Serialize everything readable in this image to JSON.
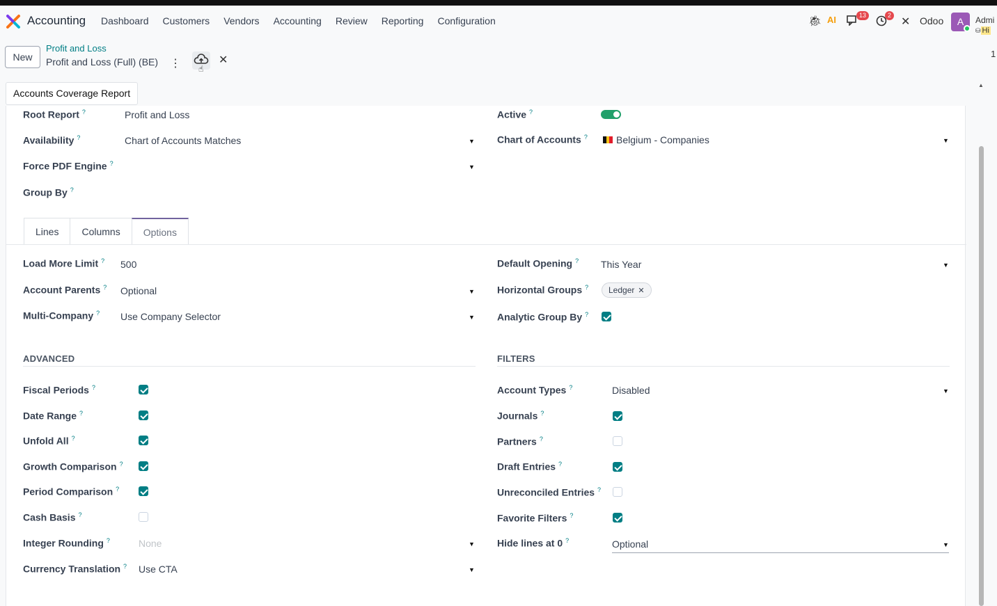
{
  "navbar": {
    "app_name": "Accounting",
    "menu": [
      "Dashboard",
      "Customers",
      "Vendors",
      "Accounting",
      "Review",
      "Reporting",
      "Configuration"
    ],
    "messages_badge": "13",
    "activities_badge": "2",
    "company": "Odoo",
    "avatar_letter": "A",
    "user": "Admi",
    "db": "Hi"
  },
  "control_panel": {
    "new_label": "New",
    "breadcrumb_parent": "Profit and Loss",
    "breadcrumb_current": "Profit and Loss (Full) (BE)",
    "pager": "1"
  },
  "coverage_button": "Accounts Coverage Report",
  "header_fields": {
    "root_report": {
      "label": "Root Report",
      "value": "Profit and Loss"
    },
    "availability": {
      "label": "Availability",
      "value": "Chart of Accounts Matches"
    },
    "force_pdf": {
      "label": "Force PDF Engine",
      "value": ""
    },
    "group_by": {
      "label": "Group By",
      "value": ""
    },
    "active": {
      "label": "Active",
      "value": true
    },
    "chart_of_accounts": {
      "label": "Chart of Accounts",
      "value": "Belgium - Companies"
    }
  },
  "tabs": [
    "Lines",
    "Columns",
    "Options"
  ],
  "options": {
    "load_more_limit": {
      "label": "Load More Limit",
      "value": "500"
    },
    "account_parents": {
      "label": "Account Parents",
      "value": "Optional"
    },
    "multi_company": {
      "label": "Multi-Company",
      "value": "Use Company Selector"
    },
    "default_opening": {
      "label": "Default Opening",
      "value": "This Year"
    },
    "horizontal_groups": {
      "label": "Horizontal Groups",
      "tag": "Ledger"
    },
    "analytic_group_by": {
      "label": "Analytic Group By",
      "checked": true
    }
  },
  "advanced": {
    "title": "ADVANCED",
    "fiscal_periods": {
      "label": "Fiscal Periods",
      "checked": true
    },
    "date_range": {
      "label": "Date Range",
      "checked": true
    },
    "unfold_all": {
      "label": "Unfold All",
      "checked": true
    },
    "growth_comparison": {
      "label": "Growth Comparison",
      "checked": true
    },
    "period_comparison": {
      "label": "Period Comparison",
      "checked": true
    },
    "cash_basis": {
      "label": "Cash Basis",
      "checked": false
    },
    "integer_rounding": {
      "label": "Integer Rounding",
      "placeholder": "None"
    },
    "currency_translation": {
      "label": "Currency Translation",
      "value": "Use CTA"
    }
  },
  "filters": {
    "title": "FILTERS",
    "account_types": {
      "label": "Account Types",
      "value": "Disabled"
    },
    "journals": {
      "label": "Journals",
      "checked": true
    },
    "partners": {
      "label": "Partners",
      "checked": false
    },
    "draft_entries": {
      "label": "Draft Entries",
      "checked": true
    },
    "unreconciled_entries": {
      "label": "Unreconciled Entries",
      "checked": false
    },
    "favorite_filters": {
      "label": "Favorite Filters",
      "checked": true
    },
    "hide_lines_at_0": {
      "label": "Hide lines at 0",
      "value": "Optional"
    }
  },
  "colors": {
    "accent": "#017e84",
    "tab_active": "#71639e",
    "toggle_on": "#22a06b",
    "badge": "#e5484d"
  },
  "help_mark": "?"
}
